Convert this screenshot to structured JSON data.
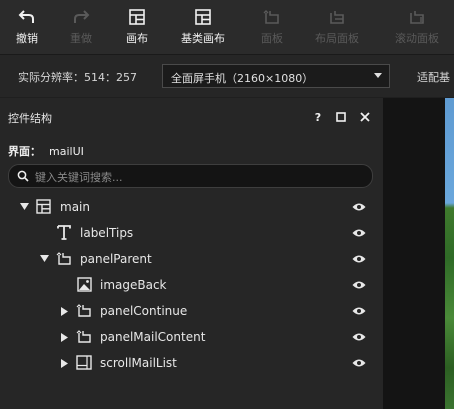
{
  "toolbar": {
    "items": [
      {
        "label": "撤销",
        "icon": "undo-icon",
        "enabled": true
      },
      {
        "label": "重做",
        "icon": "redo-icon",
        "enabled": false
      },
      {
        "label": "画布",
        "icon": "canvas-icon",
        "enabled": true
      },
      {
        "label": "基类画布",
        "icon": "base-canvas-icon",
        "enabled": true
      },
      {
        "label": "面板",
        "icon": "panel-icon",
        "enabled": false
      },
      {
        "label": "布局面板",
        "icon": "layout-panel-icon",
        "enabled": false
      },
      {
        "label": "滚动面板",
        "icon": "scroll-panel-icon",
        "enabled": false
      }
    ]
  },
  "resolution": {
    "label": "实际分辨率：514：257",
    "device": "全面屏手机（2160×1080）",
    "extra": "适配基"
  },
  "panel": {
    "title": "控件结构",
    "help": "?",
    "interface_label": "界面：",
    "interface_name": "mailUI",
    "search_placeholder": "键入关键词搜索..."
  },
  "tree": [
    {
      "label": "main",
      "icon": "canvas-icon",
      "depth": 0,
      "expanded": true
    },
    {
      "label": "labelTips",
      "icon": "text-icon",
      "depth": 1,
      "expanded": null
    },
    {
      "label": "panelParent",
      "icon": "panel-icon",
      "depth": 1,
      "expanded": true
    },
    {
      "label": "imageBack",
      "icon": "image-icon",
      "depth": 2,
      "expanded": null
    },
    {
      "label": "panelContinue",
      "icon": "panel-icon",
      "depth": 2,
      "expanded": false
    },
    {
      "label": "panelMailContent",
      "icon": "panel-icon",
      "depth": 2,
      "expanded": false
    },
    {
      "label": "scrollMailList",
      "icon": "scroll-panel-icon",
      "depth": 2,
      "expanded": false
    }
  ],
  "colors": {
    "background": "#1f1f1f",
    "panel": "#262626",
    "toolbar": "#2b2b2b",
    "enabled_text": "#f0f0f0",
    "disabled_text": "#5a5a5a"
  }
}
